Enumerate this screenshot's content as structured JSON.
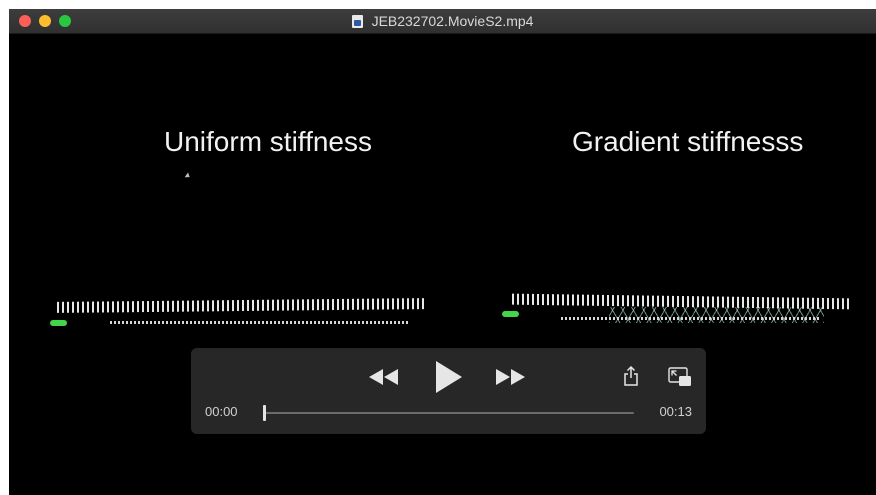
{
  "window": {
    "title": "JEB232702.MovieS2.mp4",
    "traffic_lights": [
      "close",
      "minimize",
      "zoom"
    ]
  },
  "video": {
    "caption_left": "Uniform stiffness",
    "caption_right": "Gradient stiffnesss"
  },
  "player": {
    "current_time": "00:00",
    "duration": "00:13",
    "progress": 0.0,
    "buttons": [
      "rewind-icon",
      "play-icon",
      "fast-forward-icon",
      "share-icon",
      "picture-in-picture-icon"
    ]
  },
  "colors": {
    "video_background": "#000000",
    "controls_background": "#2a2a2a",
    "model_head": "#43d64a",
    "mesh_lines": "#bfffe6"
  }
}
